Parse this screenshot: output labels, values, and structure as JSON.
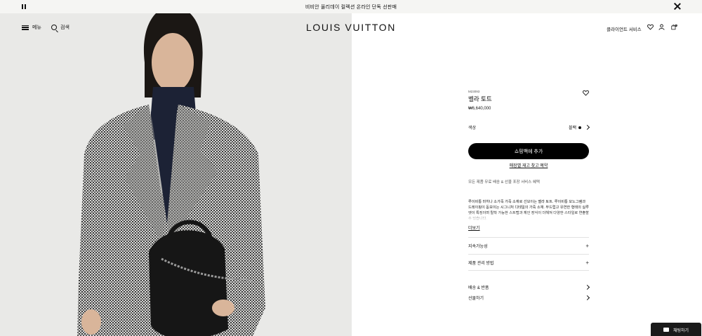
{
  "promo": {
    "text": "비비안 올리데이 컬렉션 온라인 단독 선판매"
  },
  "header": {
    "menu_label": "메뉴",
    "search_label": "검색",
    "logo": "LOUIS VUITTON",
    "contact_label": "클라이언트 서비스",
    "cart_count": "0"
  },
  "product": {
    "sku": "M23093",
    "name": "벨라 토트",
    "price": "₩6,640,000",
    "color_label": "색상",
    "color_value": "블랙",
    "add_to_cart": "쇼핑백에 추가",
    "store_link": "매장별 재고 찾고 예약",
    "services": "모든 제품 무료 배송 & 선물 포장 서비스 혜택",
    "description": "루이비통 마히나 소가죽 가죽 소재로 선보이는 벨라 토트. 루이비통 모노그램과 드레이핑이 돋보이는 시그니처 디테일의 가죽 소재. 부드럽고 유연한 형태의 실루엣이 특징이며 탈착 가능한 스트랩과 체인 장식이 더해져 다양한 스타일로 연출할 수 있습니다.",
    "more_label": "더보기",
    "accordion": [
      "지속가능성",
      "제품 관리 방법"
    ],
    "links": [
      "배송 & 반품",
      "선물하기"
    ]
  },
  "chat": {
    "label": "채팅하기"
  },
  "colors": {
    "accent": "#000000",
    "hero_bg": "#e9e9e7",
    "promo_bg": "#f5f5f3"
  }
}
